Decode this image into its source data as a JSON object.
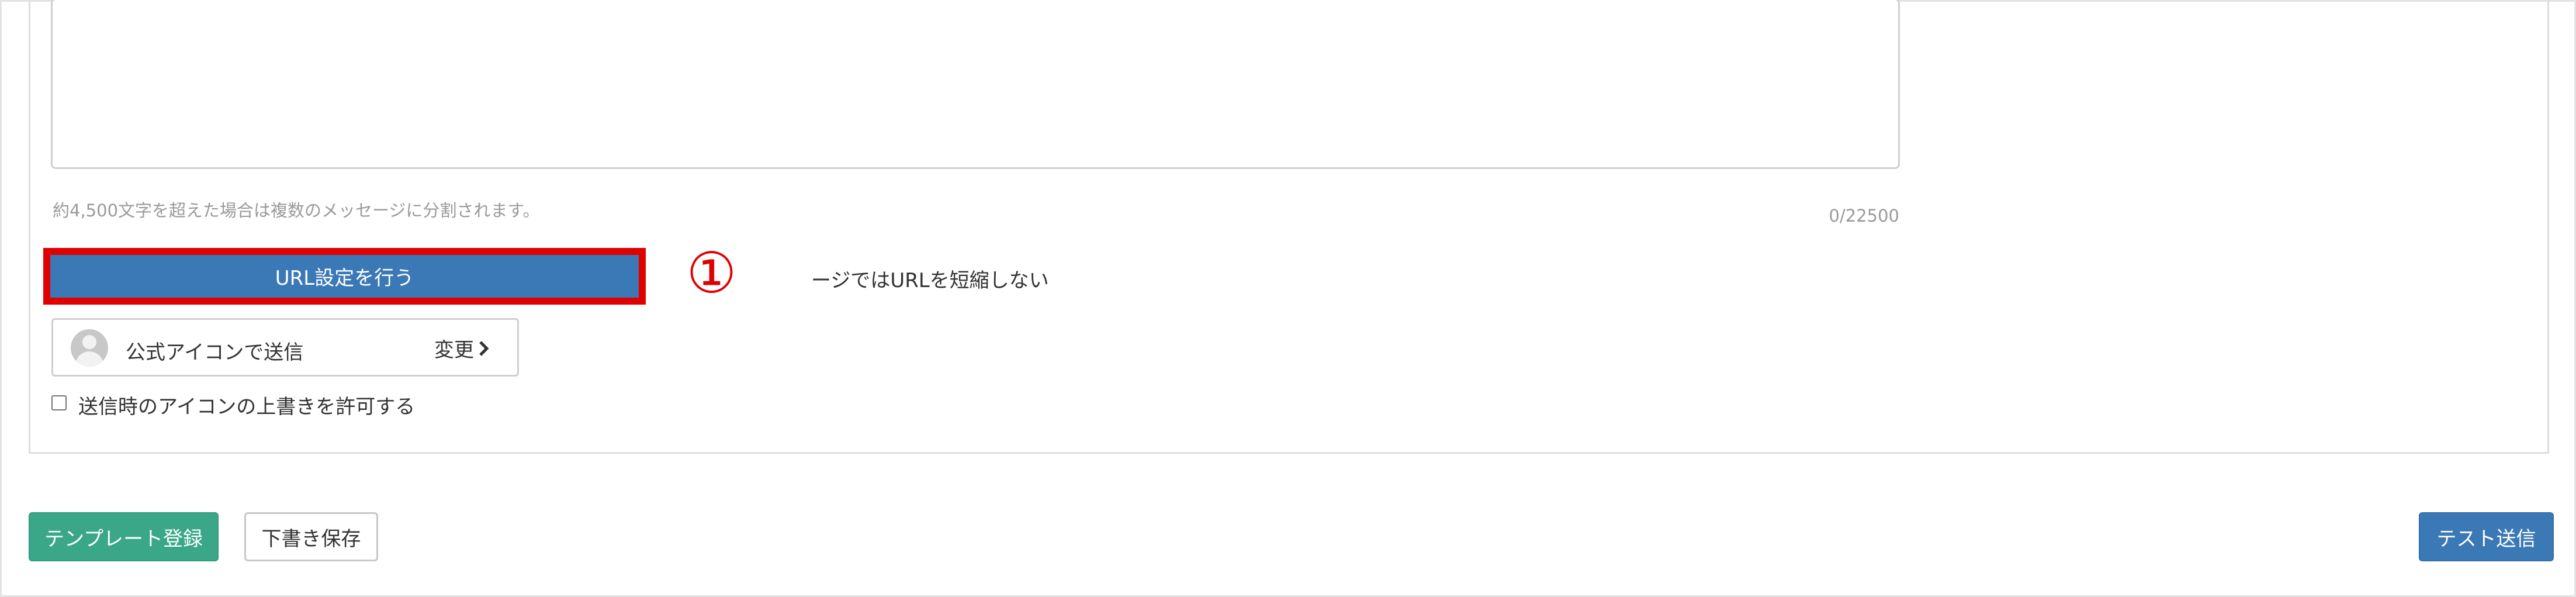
{
  "message": {
    "split_note": "約4,500文字を超えた場合は複数のメッセージに分割されます。",
    "char_counter": "0/22500"
  },
  "url_settings": {
    "button_label": "URL設定を行う",
    "step_number": "①",
    "shorten_option_text": "ージではURLを短縮しない"
  },
  "sender_icon": {
    "label": "公式アイコンで送信",
    "change_label": "変更",
    "avatar_icon": "user-avatar-icon",
    "chevron_icon": "chevron-right-icon"
  },
  "override": {
    "label": "送信時のアイコンの上書きを許可する",
    "checked": false
  },
  "footer": {
    "template_label": "テンプレート登録",
    "draft_label": "下書き保存",
    "test_send_label": "テスト送信"
  },
  "colors": {
    "primary": "#3b79b6",
    "success": "#3aa788",
    "highlight": "#e00000"
  }
}
